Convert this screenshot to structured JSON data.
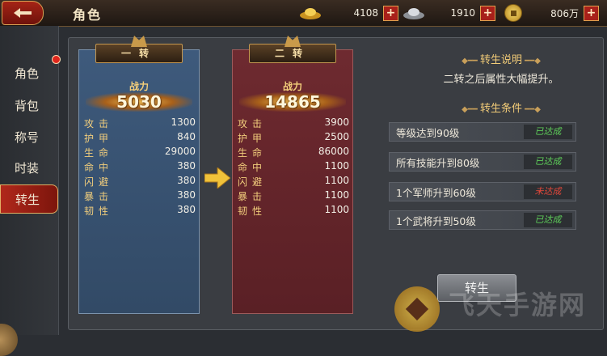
{
  "header": {
    "title": "角色",
    "resources": [
      {
        "icon": "gold-ingot-icon",
        "value": "4108"
      },
      {
        "icon": "silver-ingot-icon",
        "value": "1910"
      },
      {
        "icon": "coin-icon",
        "value": "806万"
      }
    ]
  },
  "sidebar": {
    "items": [
      {
        "label": "角色"
      },
      {
        "label": "背包"
      },
      {
        "label": "称号"
      },
      {
        "label": "时装"
      },
      {
        "label": "转生"
      }
    ],
    "active_index": 4
  },
  "cards": [
    {
      "header": "一转",
      "power_label": "战力",
      "power": "5030",
      "stats": [
        {
          "label": "攻击",
          "value": "1300"
        },
        {
          "label": "护甲",
          "value": "840"
        },
        {
          "label": "生命",
          "value": "29000"
        },
        {
          "label": "命中",
          "value": "380"
        },
        {
          "label": "闪避",
          "value": "380"
        },
        {
          "label": "暴击",
          "value": "380"
        },
        {
          "label": "韧性",
          "value": "380"
        }
      ]
    },
    {
      "header": "二转",
      "power_label": "战力",
      "power": "14865",
      "stats": [
        {
          "label": "攻击",
          "value": "3900"
        },
        {
          "label": "护甲",
          "value": "2500"
        },
        {
          "label": "生命",
          "value": "86000"
        },
        {
          "label": "命中",
          "value": "1100"
        },
        {
          "label": "闪避",
          "value": "1100"
        },
        {
          "label": "暴击",
          "value": "1100"
        },
        {
          "label": "韧性",
          "value": "1100"
        }
      ]
    }
  ],
  "info": {
    "explain_title": "转生说明",
    "explain_text": "二转之后属性大幅提升。",
    "cond_title": "转生条件",
    "conditions": [
      {
        "text": "等级达到90级",
        "status": "已达成"
      },
      {
        "text": "所有技能升到80级",
        "status": "已达成"
      },
      {
        "text": "1个军师升到60级",
        "status": "未达成"
      },
      {
        "text": "1个武将升到50级",
        "status": "已达成"
      }
    ]
  },
  "action": {
    "rebirth_label": "转生"
  },
  "watermark": "飞天手游网",
  "colors": {
    "accent": "#b0281b",
    "done": "#5fd05a",
    "not_done": "#e4483b"
  }
}
